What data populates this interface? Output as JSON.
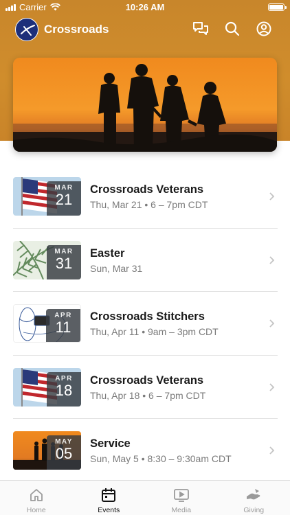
{
  "status_bar": {
    "carrier": "Carrier",
    "time": "10:26 AM"
  },
  "app": {
    "title": "Crossroads"
  },
  "header_actions": [
    {
      "icon": "chat-bubbles-icon"
    },
    {
      "icon": "search-icon"
    },
    {
      "icon": "account-icon"
    }
  ],
  "colors": {
    "header": "#d08d2c",
    "badge": "#3a3f45",
    "logo": "#1d2f7a"
  },
  "events": [
    {
      "title": "Crossroads Veterans",
      "subtitle": "Thu, Mar 21 • 6 – 7pm CDT",
      "month": "MAR",
      "day": "21"
    },
    {
      "title": "Easter",
      "subtitle": "Sun, Mar 31",
      "month": "MAR",
      "day": "31"
    },
    {
      "title": "Crossroads Stitchers",
      "subtitle": "Thu, Apr 11 • 9am – 3pm CDT",
      "month": "APR",
      "day": "11"
    },
    {
      "title": "Crossroads Veterans",
      "subtitle": "Thu, Apr 18 • 6 – 7pm CDT",
      "month": "APR",
      "day": "18"
    },
    {
      "title": "Service",
      "subtitle": "Sun, May 5 • 8:30 – 9:30am CDT",
      "month": "MAY",
      "day": "05"
    }
  ],
  "tabs": [
    {
      "label": "Home",
      "icon": "home-icon"
    },
    {
      "label": "Events",
      "icon": "calendar-icon",
      "active": true
    },
    {
      "label": "Media",
      "icon": "media-play-icon"
    },
    {
      "label": "Giving",
      "icon": "giving-hand-icon"
    }
  ]
}
